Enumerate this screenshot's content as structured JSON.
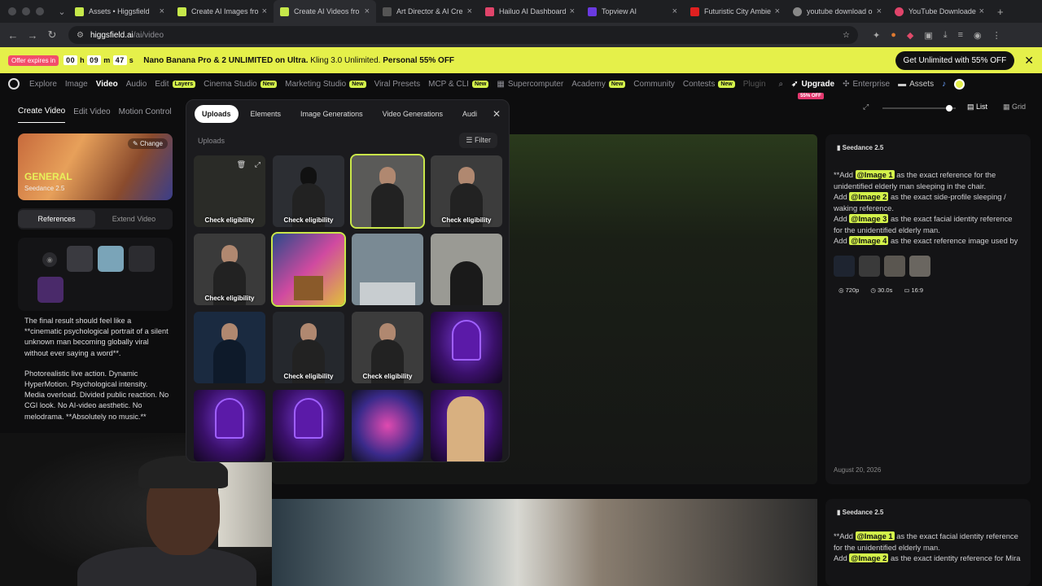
{
  "browser": {
    "tabs": [
      {
        "title": "Assets • Higgsfield",
        "color": "#c6e84a"
      },
      {
        "title": "Create AI Images fro",
        "color": "#c6e84a"
      },
      {
        "title": "Create AI Videos fro",
        "color": "#c6e84a",
        "active": true
      },
      {
        "title": "Art Director & AI Cre",
        "color": "#555"
      },
      {
        "title": "Hailuo AI Dashboard",
        "color": "#e0446a"
      },
      {
        "title": "Topview AI",
        "color": "#6a3ae0"
      },
      {
        "title": "Futuristic City Ambie",
        "color": "#e02020"
      },
      {
        "title": "youtube download o",
        "color": "#888"
      },
      {
        "title": "YouTube Downloader",
        "color": "#e0446a"
      }
    ],
    "url_host": "higgsfield.ai",
    "url_path": "/ai/video"
  },
  "promo": {
    "offer": "Offer expires in",
    "h": "00",
    "hl": "h",
    "m": "09",
    "ml": "m",
    "s": "47",
    "sl": "s",
    "text_bold": "Nano Banana Pro & 2 UNLIMITED on Ultra.",
    "text_mid": " Kling 3.0 Unlimited. ",
    "text_bold2": "Personal 55% OFF",
    "cta": "Get Unlimited with 55% OFF"
  },
  "nav": {
    "explore": "Explore",
    "image": "Image",
    "video": "Video",
    "audio": "Audio",
    "edit": "Edit",
    "layers": "Layers",
    "cinema": "Cinema Studio",
    "new": "New",
    "marketing": "Marketing Studio",
    "viral": "Viral Presets",
    "mcp": "MCP & CLI",
    "super": "Supercomputer",
    "academy": "Academy",
    "community": "Community",
    "contests": "Contests",
    "plugins": "Plugin",
    "upgrade": "Upgrade",
    "off": "55% OFF",
    "enterprise": "Enterprise",
    "assets": "Assets"
  },
  "left": {
    "tabs": [
      "Create Video",
      "Edit Video",
      "Motion Control"
    ],
    "model_change": "Change",
    "model_name": "GENERAL",
    "model_sub": "Seedance 2.5",
    "ref_tabs": [
      "References",
      "Extend Video"
    ],
    "prompt_p1": "The final result should feel like a **cinematic psychological portrait of a silent unknown man becoming globally viral without ever saying a word**.",
    "prompt_p2": "Photorealistic live action. Dynamic HyperMotion. Psychological intensity. Media overload. Divided public reaction. No CGI look. No AI-video aesthetic. No melodrama. **Absolutely no music.**"
  },
  "view": {
    "list": "List",
    "grid": "Grid"
  },
  "picker": {
    "tabs": [
      "Uploads",
      "Elements",
      "Image Generations",
      "Video Generations",
      "Audi"
    ],
    "section": "Uploads",
    "filter": "Filter",
    "check": "Check eligibility"
  },
  "right": {
    "card1": {
      "model": "Seedance 2.5",
      "l1a": "**Add ",
      "l1t": "@Image 1",
      "l1b": " as the exact reference for the unidentified elderly man sleeping in the chair.",
      "l2a": "Add ",
      "l2t": "@Image 2",
      "l2b": " as the exact side-profile sleeping / waking reference.",
      "l3a": "Add ",
      "l3t": "@Image 3",
      "l3b": " as the exact facial identity reference for the unidentified elderly man.",
      "l4a": "Add ",
      "l4t": "@Image 4",
      "l4b": " as the exact reference image used by the public, social media, news broadcasts and",
      "res": "720p",
      "dur": "30.0s",
      "ratio": "16:9",
      "date": "August 20, 2026"
    },
    "card2": {
      "model": "Seedance 2.5",
      "l1a": "**Add ",
      "l1t": "@Image 1",
      "l1b": " as the exact facial identity reference for the unidentified elderly man.",
      "l2a": "Add ",
      "l2t": "@Image 2",
      "l2b": " as the exact identity reference for Mira"
    }
  }
}
